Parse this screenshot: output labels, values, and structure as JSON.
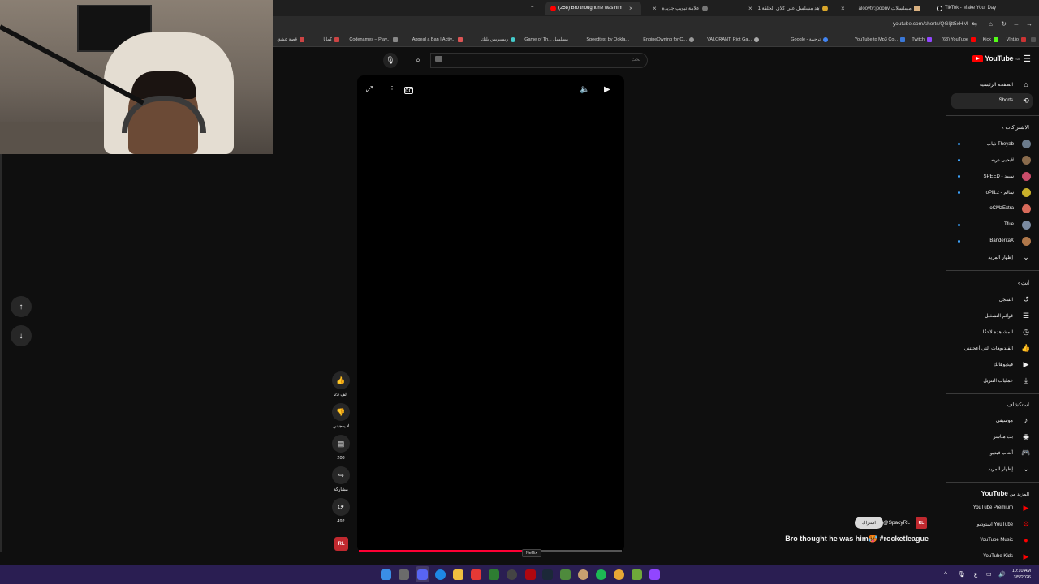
{
  "browser": {
    "tabs": [
      {
        "label": "TikTok - Make Your Day",
        "active": false
      },
      {
        "label": "alooytv:jooonv مسلسلات",
        "active": false
      },
      {
        "label": "شاهد مسلسل علي كلاي الحلقة 1",
        "active": false
      },
      {
        "label": "علامة تبويب جديدة",
        "active": false
      },
      {
        "label": "(258) Bro thought he was him",
        "active": true
      }
    ],
    "new_tab": "+",
    "address": "youtube.com/shorts/QGljtt5xHM",
    "bookmarks": [
      "Vlnt.io",
      "Kick",
      "(63) YouTube",
      "Twitch",
      "YouTube to Mp3 Co...",
      "Google - ترجمة",
      "VALORANT: Riot Ga...",
      "EngineOwning for C...",
      "Speedtest by Ookla...",
      "Game of Th... مسلسل",
      "ريسبوبس بلتك",
      "Appeal a Ban | Activ...",
      "Codenames – Play...",
      "كمانا",
      "قصة عشق"
    ]
  },
  "youtube": {
    "logo_text": "YouTube",
    "logo_region": "SA",
    "search_placeholder": "بحث",
    "sidebar": {
      "home": "الصفحة الرئيسية",
      "shorts": "Shorts",
      "subscriptions_header": "الاشتراكات",
      "subscriptions": [
        {
          "name": "ذياب Theyab",
          "color": "#6b7b8c",
          "dot": true
        },
        {
          "name": "يحيى دريه#",
          "color": "#8a6b4c",
          "dot": true
        },
        {
          "name": "SPEED - سبيد",
          "color": "#c94c6a",
          "dot": true
        },
        {
          "name": "oPiiLz - سالم",
          "color": "#c9b02a",
          "dot": true
        },
        {
          "name": "oCMzExtra",
          "color": "#d86a5a",
          "dot": false
        },
        {
          "name": "Tfue",
          "color": "#7a8aa0",
          "dot": true
        },
        {
          "name": "BanderitaX",
          "color": "#b0784a",
          "dot": true
        }
      ],
      "show_more": "إظهار المزيد",
      "you_header": "أنت",
      "you_items": [
        {
          "label": "السجل",
          "icon": "history-icon"
        },
        {
          "label": "قوائم التشغيل",
          "icon": "playlists-icon"
        },
        {
          "label": "المشاهدة لاحقًا",
          "icon": "watch-later-icon"
        },
        {
          "label": "الفيديوهات التي أعجبتني",
          "icon": "liked-icon"
        },
        {
          "label": "فيديوهاتك",
          "icon": "your-videos-icon"
        },
        {
          "label": "عمليات التنزيل",
          "icon": "downloads-icon"
        }
      ],
      "explore_header": "استكشاف",
      "explore_items": [
        {
          "label": "موسيقى",
          "icon": "music-icon"
        },
        {
          "label": "بث مباشر",
          "icon": "live-icon"
        },
        {
          "label": "ألعاب فيديو",
          "icon": "gaming-icon"
        }
      ],
      "show_more_2": "إظهار المزيد",
      "more_from_header_prefix": "المزيد من",
      "more_from_header_brand": "YouTube",
      "more_items": [
        "YouTube Premium",
        "استوديو YouTube",
        "YouTube Music",
        "YouTube Kids"
      ]
    },
    "player": {
      "tooltip": "Netflix",
      "progress_fraction": 0.62
    },
    "actions": {
      "likes": "23 ألف",
      "dislike": "لا يعجبني",
      "comments": "208",
      "share": "مشاركة",
      "remix": "492"
    },
    "video": {
      "subscribe": "اشتراك",
      "channel_handle": "@SpacyRL",
      "channel_badge": "RL",
      "title": "Bro thought he was him🥵 #rocketleague"
    }
  },
  "taskbar": {
    "time": "10:10 AM",
    "date": "3/5/2026",
    "lang": "ع"
  }
}
